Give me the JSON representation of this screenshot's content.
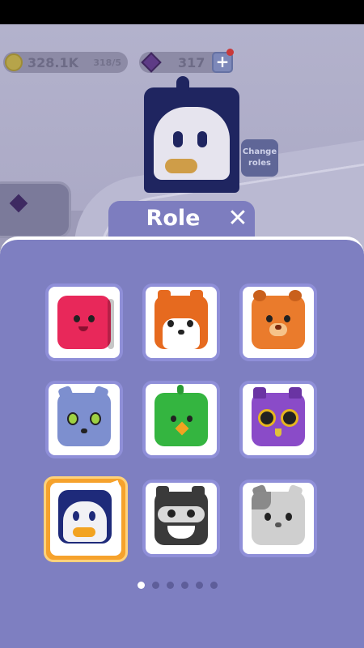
{
  "hud": {
    "coins": "328.1K",
    "coin_capacity": "318/5",
    "gems": "317",
    "plus_label": "+"
  },
  "change_roles": {
    "line1": "Change",
    "line2": "roles"
  },
  "dialog": {
    "title": "Role",
    "close_label": "✕"
  },
  "roles": [
    {
      "id": "red-jelly",
      "body_color": "#e8285a",
      "selected": false
    },
    {
      "id": "fox",
      "body_color": "#e66a1f",
      "selected": false
    },
    {
      "id": "bear",
      "body_color": "#ea7b2c",
      "selected": false
    },
    {
      "id": "blue-cat",
      "body_color": "#7d8fcf",
      "selected": false
    },
    {
      "id": "green-bird",
      "body_color": "#34b540",
      "selected": false
    },
    {
      "id": "owl",
      "body_color": "#8a4bc8",
      "selected": false
    },
    {
      "id": "penguin",
      "body_color": "#1e2a7a",
      "selected": true
    },
    {
      "id": "raccoon",
      "body_color": "#3a3a3a",
      "selected": false
    },
    {
      "id": "grey-cat",
      "body_color": "#cfcfcf",
      "selected": false
    }
  ],
  "pagination": {
    "total": 6,
    "current": 1
  },
  "colors": {
    "panel": "#7e7fc1",
    "tile_border": "#8f8fd8",
    "selected_tile": "#f6a22c"
  }
}
